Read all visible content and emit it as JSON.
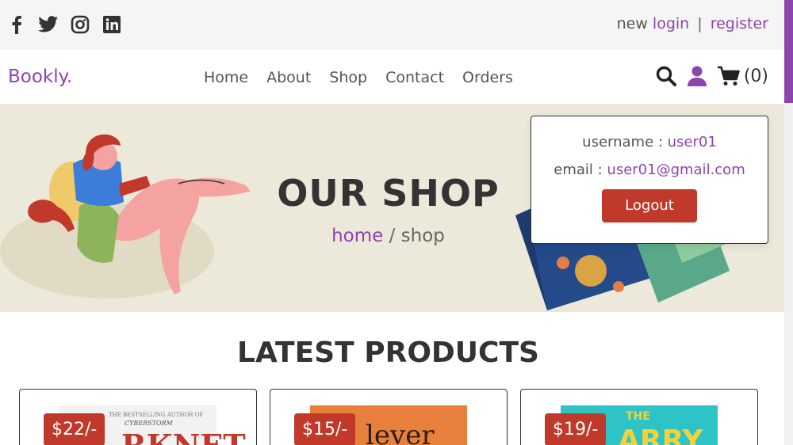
{
  "header_top": {
    "socials": [
      "facebook-icon",
      "twitter-icon",
      "instagram-icon",
      "linkedin-icon"
    ],
    "auth_prefix": "new",
    "login_label": "login",
    "separator": "|",
    "register_label": "register"
  },
  "header_main": {
    "logo": "Bookly.",
    "nav": [
      "Home",
      "About",
      "Shop",
      "Contact",
      "Orders"
    ],
    "cart_count": "(0)"
  },
  "hero": {
    "title": "OUR SHOP",
    "crumb_home": "home",
    "crumb_sep": " / ",
    "crumb_current": "shop"
  },
  "profile": {
    "username_label": "username : ",
    "username": "user01",
    "email_label": "email : ",
    "email": "user01@gmail.com",
    "logout_label": "Logout"
  },
  "products": {
    "title": "LATEST PRODUCTS",
    "items": [
      {
        "price": "$22/-",
        "cover_top": "THE BESTSELLING AUTHOR OF",
        "cover_sub": "CYBERSTORM",
        "cover_title": "RKNET"
      },
      {
        "price": "$15/-",
        "cover_title": "lever"
      },
      {
        "price": "$19/-",
        "cover_top": "THE",
        "cover_title": "ARRY"
      }
    ]
  },
  "colors": {
    "accent": "#8e44ad",
    "danger": "#c0392b",
    "hero_bg": "#ece8da"
  }
}
